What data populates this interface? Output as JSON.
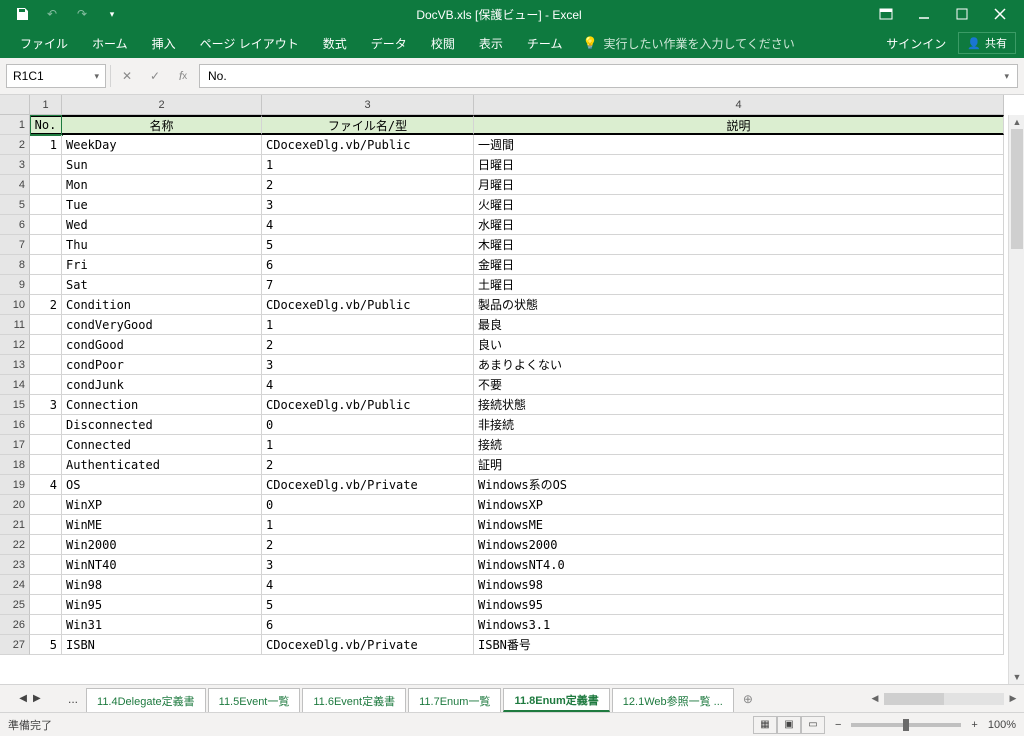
{
  "titlebar": {
    "title": "DocVB.xls [保護ビュー] - Excel"
  },
  "ribbon": {
    "tabs": [
      "ファイル",
      "ホーム",
      "挿入",
      "ページ レイアウト",
      "数式",
      "データ",
      "校閲",
      "表示",
      "チーム"
    ],
    "tellme": "実行したい作業を入力してください",
    "signin": "サインイン",
    "share": "共有"
  },
  "formulabar": {
    "namebox": "R1C1",
    "formula": "No."
  },
  "columns": {
    "labels": [
      "1",
      "2",
      "3",
      "4"
    ],
    "widths": [
      32,
      200,
      212,
      530
    ]
  },
  "headers": [
    "No.",
    "名称",
    "ファイル名/型",
    "説明"
  ],
  "rows": [
    [
      "1",
      "WeekDay",
      "CDocexeDlg.vb/Public",
      "一週間"
    ],
    [
      "",
      "Sun",
      "1",
      "日曜日"
    ],
    [
      "",
      "Mon",
      "2",
      "月曜日"
    ],
    [
      "",
      "Tue",
      "3",
      "火曜日"
    ],
    [
      "",
      "Wed",
      "4",
      "水曜日"
    ],
    [
      "",
      "Thu",
      "5",
      "木曜日"
    ],
    [
      "",
      "Fri",
      "6",
      "金曜日"
    ],
    [
      "",
      "Sat",
      "7",
      "土曜日"
    ],
    [
      "2",
      "Condition",
      "CDocexeDlg.vb/Public",
      "製品の状態"
    ],
    [
      "",
      "condVeryGood",
      "1",
      "最良"
    ],
    [
      "",
      "condGood",
      "2",
      "良い"
    ],
    [
      "",
      "condPoor",
      "3",
      "あまりよくない"
    ],
    [
      "",
      "condJunk",
      "4",
      "不要"
    ],
    [
      "3",
      "Connection",
      "CDocexeDlg.vb/Public",
      "接続状態"
    ],
    [
      "",
      "Disconnected",
      "0",
      "非接続"
    ],
    [
      "",
      "Connected",
      "1",
      "接続"
    ],
    [
      "",
      "Authenticated",
      "2",
      "証明"
    ],
    [
      "4",
      "OS",
      "CDocexeDlg.vb/Private",
      "Windows系のOS"
    ],
    [
      "",
      "WinXP",
      "0",
      "WindowsXP"
    ],
    [
      "",
      "WinME",
      "1",
      "WindowsME"
    ],
    [
      "",
      "Win2000",
      "2",
      "Windows2000"
    ],
    [
      "",
      "WinNT40",
      "3",
      "WindowsNT4.0"
    ],
    [
      "",
      "Win98",
      "4",
      "Windows98"
    ],
    [
      "",
      "Win95",
      "5",
      "Windows95"
    ],
    [
      "",
      "Win31",
      "6",
      "Windows3.1"
    ],
    [
      "5",
      "ISBN",
      "CDocexeDlg.vb/Private",
      "ISBN番号"
    ]
  ],
  "visible_row_count": 27,
  "sheetbar": {
    "more": "...",
    "tabs": [
      "11.4Delegate定義書",
      "11.5Event一覧",
      "11.6Event定義書",
      "11.7Enum一覧",
      "11.8Enum定義書",
      "12.1Web参照一覧 ..."
    ],
    "active_index": 4
  },
  "statusbar": {
    "left": "準備完了",
    "zoom": "100%"
  }
}
